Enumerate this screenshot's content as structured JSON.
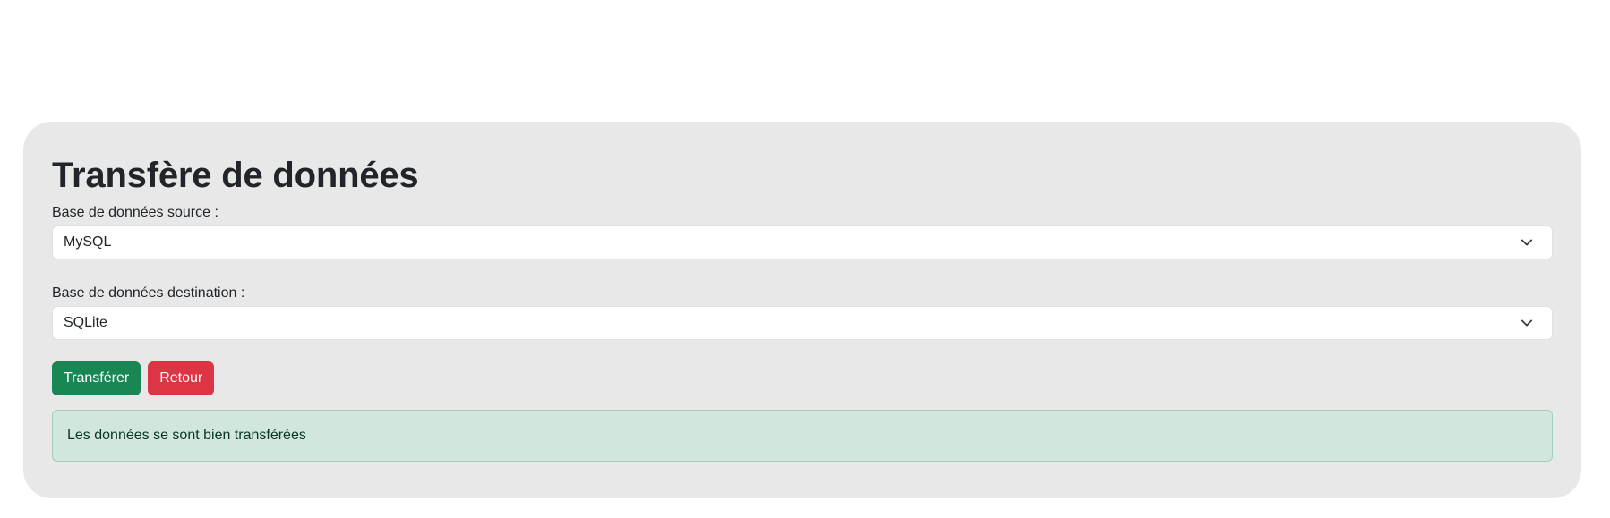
{
  "panel": {
    "title": "Transfère de données"
  },
  "form": {
    "source": {
      "label": "Base de données source :",
      "selected": "MySQL",
      "icon": "chevron-down-icon"
    },
    "destination": {
      "label": "Base de données destination :",
      "selected": "SQLite",
      "icon": "chevron-down-icon"
    }
  },
  "actions": {
    "transfer_label": "Transférer",
    "back_label": "Retour"
  },
  "alert": {
    "message": "Les données se sont bien transférées"
  },
  "colors": {
    "panel_bg": "#e8e8e8",
    "success": "#198754",
    "danger": "#dc3545",
    "alert_bg": "#d1e7dd",
    "alert_text": "#0a3622"
  }
}
